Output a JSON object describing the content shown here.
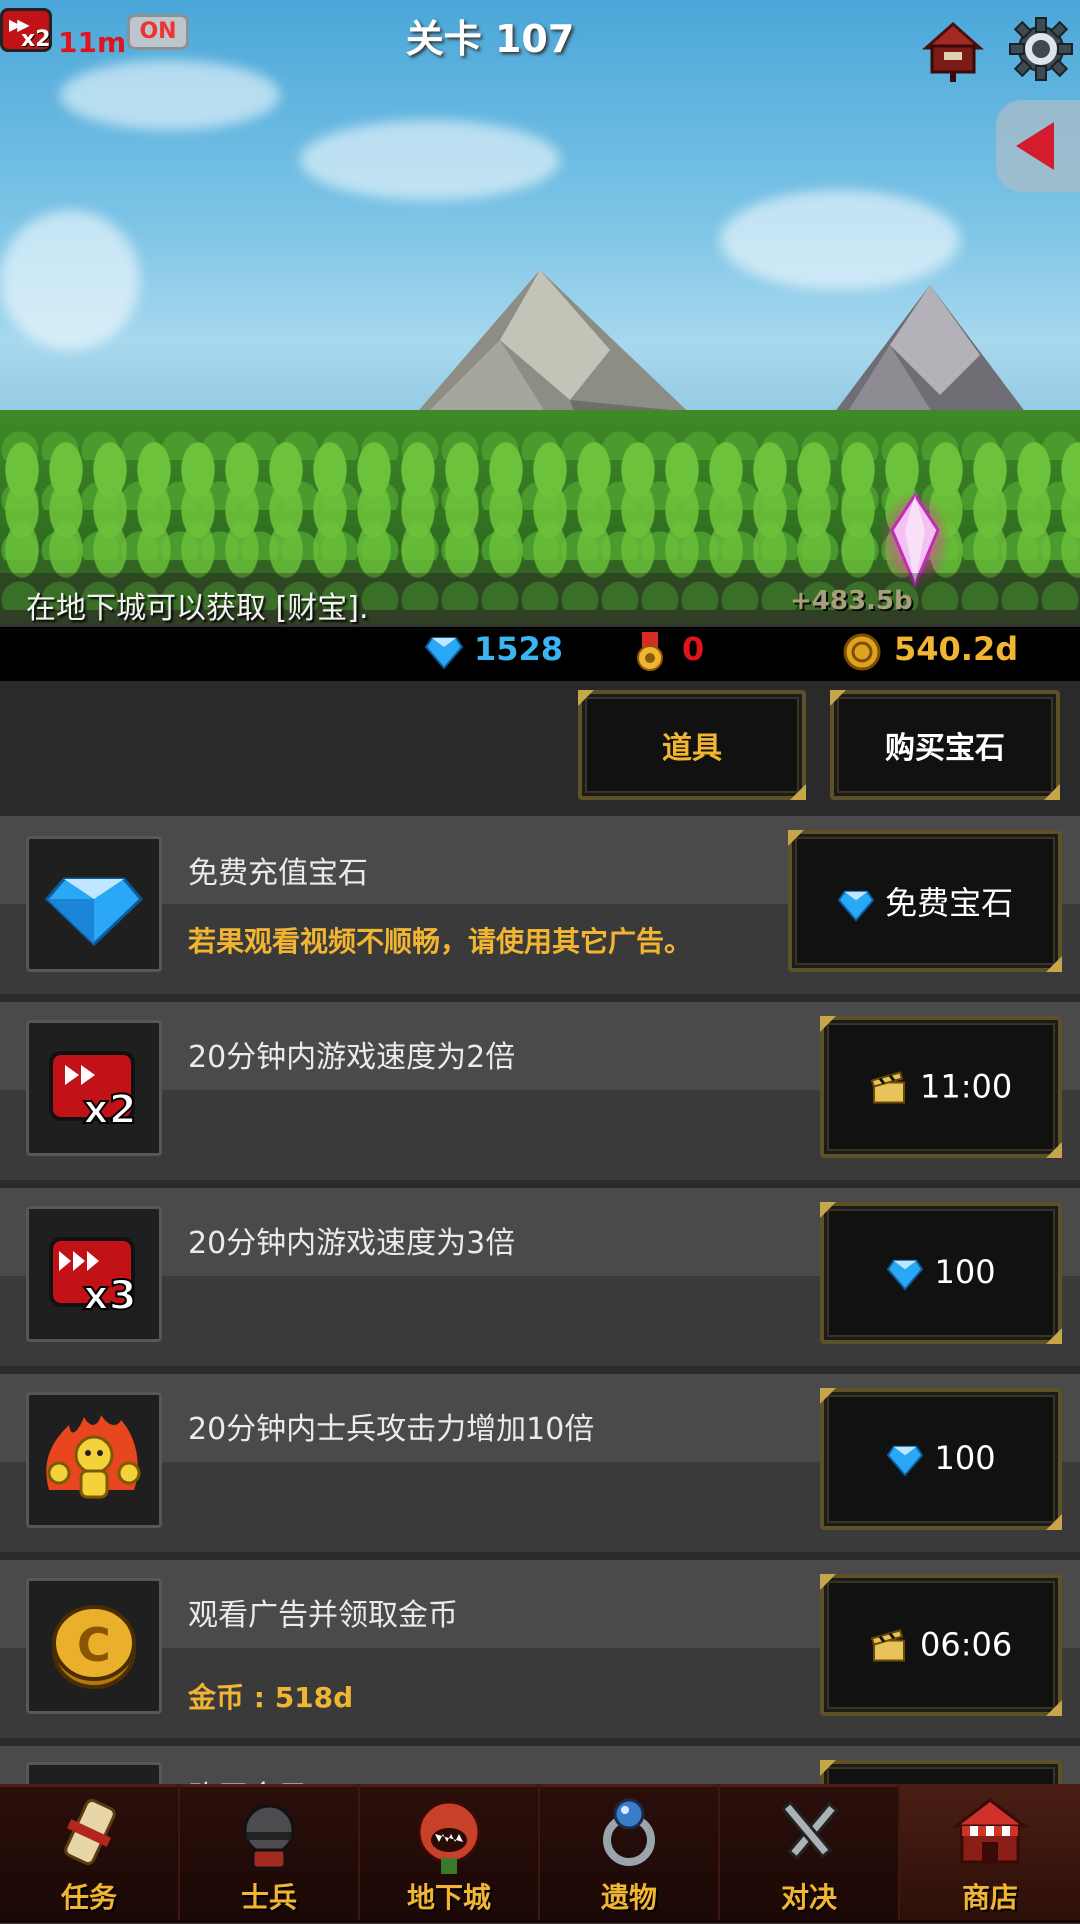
{
  "hud": {
    "speed_badge": "x2",
    "speed_time": "11m",
    "speed_toggle": "ON",
    "stage_title": "关卡 107",
    "scene_message": "在地下城可以获取 [财宝].",
    "damage_text": "+483.5b"
  },
  "currency": {
    "gems": "1528",
    "medals": "0",
    "gold": "540.2d"
  },
  "tabs": {
    "items_label": "道具",
    "buy_gems_label": "购买宝石"
  },
  "shop": {
    "items": [
      {
        "title": "免费充值宝石",
        "subtitle": "若果观看视频不顺畅，请使用其它广告。",
        "price": "免费宝石",
        "price_icon": "gem-icon"
      },
      {
        "title": "20分钟内游戏速度为2倍",
        "subtitle": "",
        "price": "11:00",
        "price_icon": "clapper-icon"
      },
      {
        "title": "20分钟内游戏速度为3倍",
        "subtitle": "",
        "price": "100",
        "price_icon": "gem-icon"
      },
      {
        "title": "20分钟内士兵攻击力增加10倍",
        "subtitle": "",
        "price": "100",
        "price_icon": "gem-icon"
      },
      {
        "title": "观看广告并领取金币",
        "subtitle": "金币 : 518d",
        "price": "06:06",
        "price_icon": "clapper-icon"
      },
      {
        "title": "购买金子",
        "subtitle": "",
        "price": "",
        "price_icon": ""
      }
    ]
  },
  "nav": {
    "items": [
      {
        "label": "任务",
        "icon": "scroll-icon"
      },
      {
        "label": "士兵",
        "icon": "soldier-helmet-icon"
      },
      {
        "label": "地下城",
        "icon": "dungeon-monster-icon"
      },
      {
        "label": "遗物",
        "icon": "relic-ring-icon"
      },
      {
        "label": "对决",
        "icon": "crossed-swords-icon"
      },
      {
        "label": "商店",
        "icon": "shop-icon"
      }
    ],
    "active": "商店"
  },
  "colors": {
    "gold_text": "#f2b531",
    "gem_blue": "#2aa7f5",
    "medal_red": "#e0151b",
    "button_border": "#c7a64a"
  }
}
